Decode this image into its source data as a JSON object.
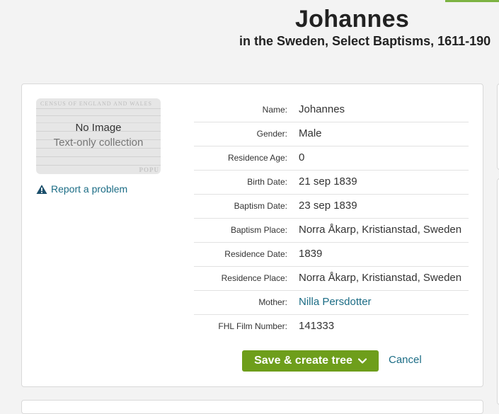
{
  "header": {
    "title": "Johannes",
    "subtitle": "in the Sweden, Select Baptisms, 1611-190"
  },
  "thumbnail": {
    "doc_header": "CENSUS OF ENGLAND AND WALES",
    "doc_footer": "POPU",
    "no_image": "No Image",
    "text_only": "Text-only collection"
  },
  "report": {
    "icon": "warning-icon",
    "label": "Report a problem"
  },
  "facts": [
    {
      "label": "Name:",
      "value": "Johannes"
    },
    {
      "label": "Gender:",
      "value": "Male"
    },
    {
      "label": "Residence Age:",
      "value": "0"
    },
    {
      "label": "Birth Date:",
      "value": "21 sep 1839"
    },
    {
      "label": "Baptism Date:",
      "value": "23 sep 1839"
    },
    {
      "label": "Baptism Place:",
      "value": "Norra Åkarp, Kristianstad, Sweden"
    },
    {
      "label": "Residence Date:",
      "value": "1839"
    },
    {
      "label": "Residence Place:",
      "value": "Norra Åkarp, Kristianstad, Sweden"
    },
    {
      "label": "Mother:",
      "value": "Nilla Persdotter"
    },
    {
      "label": "FHL Film Number:",
      "value": "141333"
    }
  ],
  "actions": {
    "save_label": "Save & create tree",
    "cancel_label": "Cancel"
  },
  "colors": {
    "accent": "#6e9e1b",
    "link": "#1b6c85",
    "top_accent": "#7cb342"
  }
}
